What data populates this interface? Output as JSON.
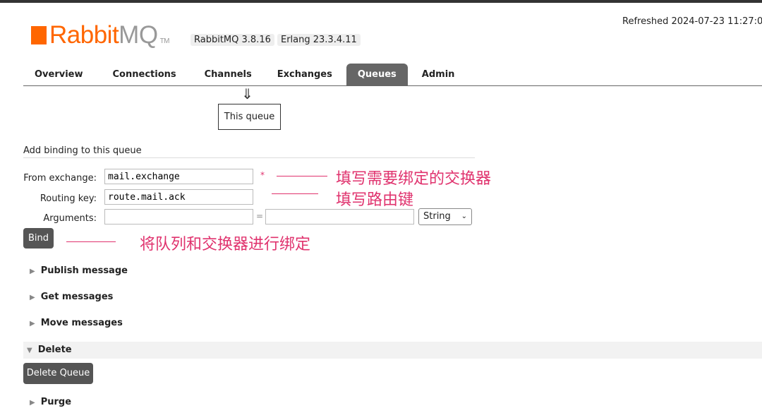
{
  "header": {
    "logo_text": "RabbitMQ",
    "logo_tm": "TM",
    "version": "RabbitMQ 3.8.16",
    "erlang": "Erlang 23.3.4.11",
    "refreshed": "Refreshed 2024-07-23 11:27:03"
  },
  "tabs": [
    {
      "label": "Overview"
    },
    {
      "label": "Connections"
    },
    {
      "label": "Channels"
    },
    {
      "label": "Exchanges"
    },
    {
      "label": "Queues",
      "active": true
    },
    {
      "label": "Admin"
    }
  ],
  "diagram": {
    "arrow": "⇓",
    "this_queue": "This queue"
  },
  "binding": {
    "title": "Add binding to this queue",
    "from_label": "From exchange:",
    "from_value": "mail.exchange",
    "required": "*",
    "routing_label": "Routing key:",
    "routing_value": "route.mail.ack",
    "args_label": "Arguments:",
    "args_key": "",
    "args_eq": "=",
    "args_value": "",
    "type_select": "String",
    "bind_label": "Bind"
  },
  "annotations": {
    "exchange": "填写需要绑定的交换器",
    "routing": "填写路由键",
    "bind": "将队列和交换器进行绑定",
    "color": "#e0336e"
  },
  "sections": {
    "publish": "Publish message",
    "get": "Get messages",
    "move": "Move messages",
    "delete": "Delete",
    "delete_button": "Delete Queue",
    "purge": "Purge"
  }
}
